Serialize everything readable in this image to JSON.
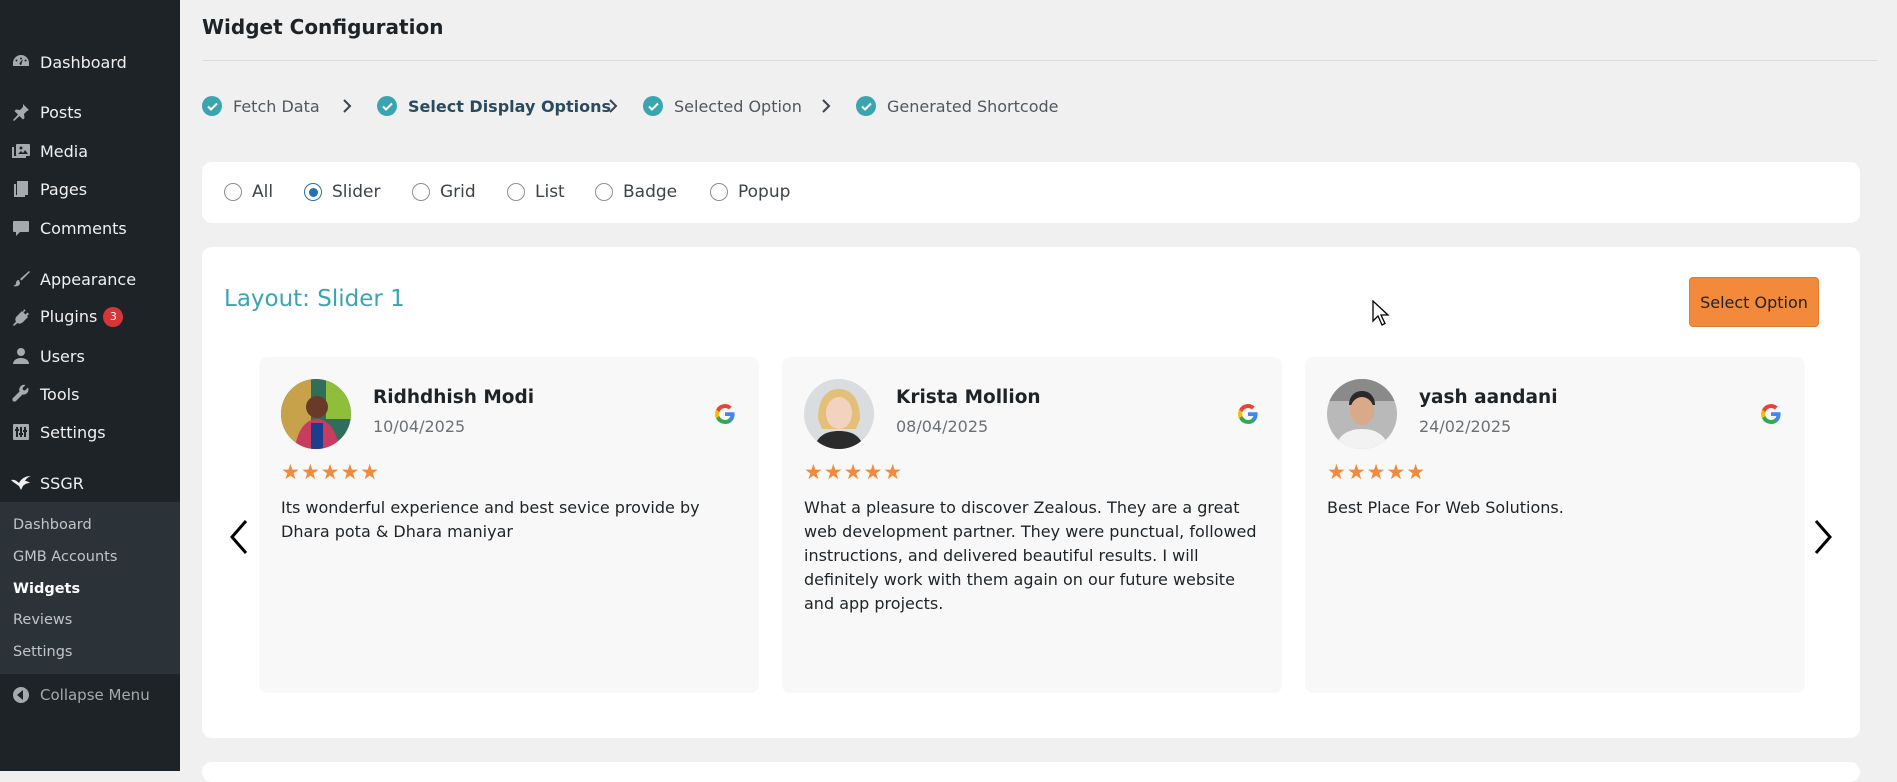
{
  "sidebar": {
    "menu": [
      {
        "label": "Dashboard",
        "icon": "dashboard-icon"
      },
      {
        "label": "Posts",
        "icon": "pin-icon"
      },
      {
        "label": "Media",
        "icon": "media-icon"
      },
      {
        "label": "Pages",
        "icon": "pages-icon"
      },
      {
        "label": "Comments",
        "icon": "comment-icon"
      },
      {
        "label": "Appearance",
        "icon": "brush-icon"
      },
      {
        "label": "Plugins",
        "icon": "plugin-icon",
        "badge": "3"
      },
      {
        "label": "Users",
        "icon": "user-icon"
      },
      {
        "label": "Tools",
        "icon": "wrench-icon"
      },
      {
        "label": "Settings",
        "icon": "settings-icon"
      },
      {
        "label": "SSGR",
        "icon": "bird-icon"
      }
    ],
    "submenu": [
      {
        "label": "Dashboard"
      },
      {
        "label": "GMB Accounts"
      },
      {
        "label": "Widgets",
        "current": true
      },
      {
        "label": "Reviews"
      },
      {
        "label": "Settings"
      }
    ],
    "collapse_label": "Collapse Menu"
  },
  "page": {
    "title": "Widget Configuration"
  },
  "steps": [
    {
      "label": "Fetch Data"
    },
    {
      "label": "Select Display Options",
      "active": true
    },
    {
      "label": "Selected Option"
    },
    {
      "label": "Generated Shortcode"
    }
  ],
  "display_options": {
    "options": [
      "All",
      "Slider",
      "Grid",
      "List",
      "Badge",
      "Popup"
    ],
    "selected": "Slider"
  },
  "layout": {
    "title": "Layout: Slider 1",
    "select_button": "Select Option"
  },
  "reviews": [
    {
      "name": "Ridhdhish Modi",
      "date": "10/04/2025",
      "stars": "★★★★★",
      "text": "Its wonderful experience and best sevice provide by Dhara pota & Dhara maniyar"
    },
    {
      "name": "Krista Mollion",
      "date": "08/04/2025",
      "stars": "★★★★★",
      "text": "What a pleasure to discover Zealous. They are a great web development partner. They were punctual, followed instructions, and delivered beautiful results. I will definitely work with them again on our future website and app projects."
    },
    {
      "name": "yash aandani",
      "date": "24/02/2025",
      "stars": "★★★★★",
      "text": "Best Place For Web Solutions."
    }
  ],
  "colors": {
    "sidebar_bg": "#1d2327",
    "accent_teal": "#3aa5b0",
    "button_orange": "#f2893b",
    "star_orange": "#f2893b",
    "radio_blue": "#2271b1"
  }
}
